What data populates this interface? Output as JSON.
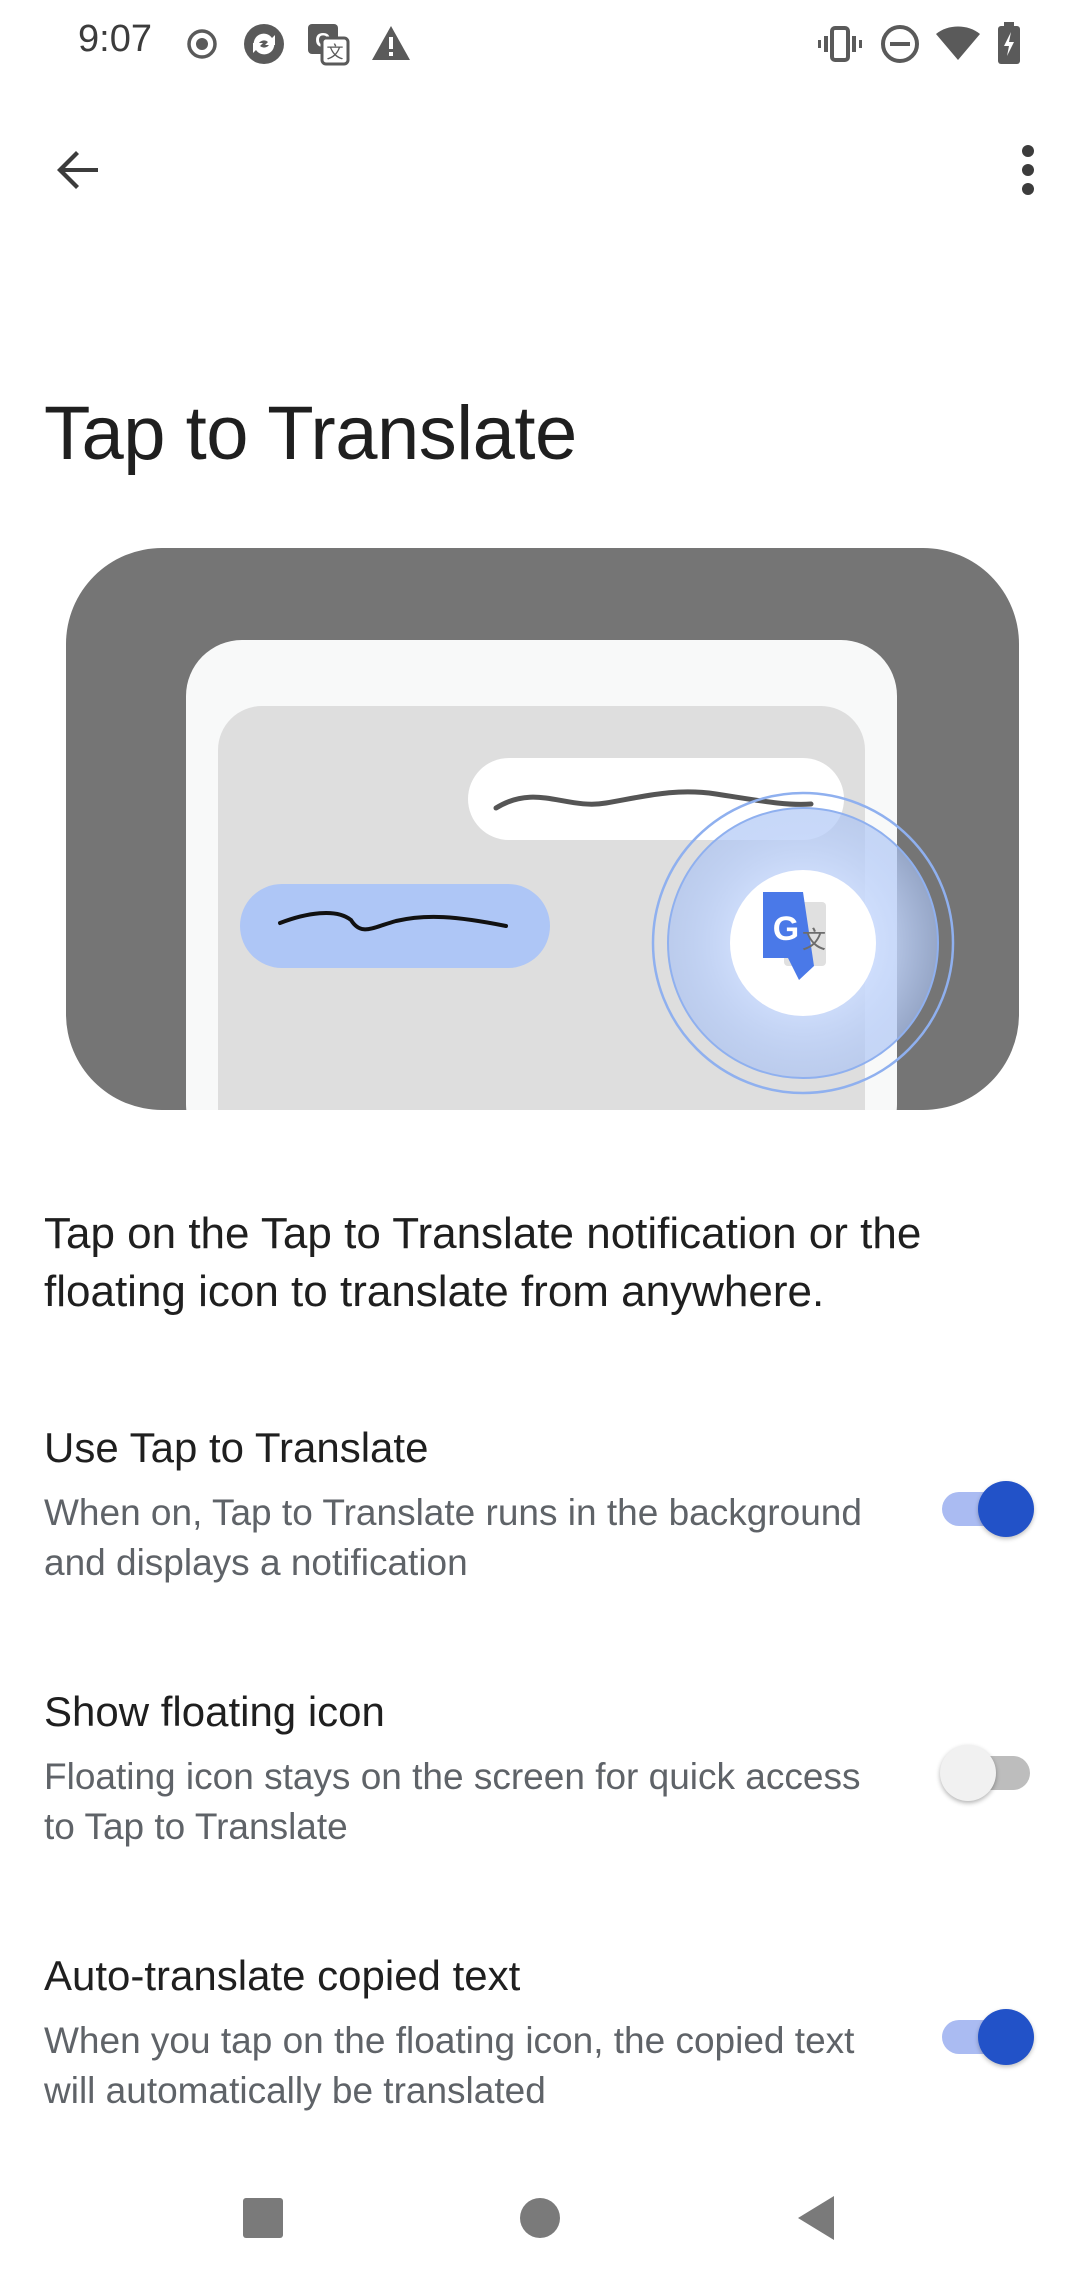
{
  "status_bar": {
    "time": "9:07",
    "left_icons": [
      "record-icon",
      "sync-icon",
      "translate-notification-icon",
      "warning-icon"
    ],
    "right_icons": [
      "vibrate-icon",
      "do-not-disturb-icon",
      "wifi-icon",
      "battery-charging-icon"
    ]
  },
  "app_bar": {
    "back_icon": "arrow-back-icon",
    "menu_icon": "more-vert-icon"
  },
  "page": {
    "title": "Tap to Translate",
    "description": "Tap on the Tap to Translate notification or the floating icon to translate from anywhere."
  },
  "settings": [
    {
      "title": "Use Tap to Translate",
      "summary": "When on, Tap to Translate runs in the background and displays a notification",
      "enabled": true
    },
    {
      "title": "Show floating icon",
      "summary": "Floating icon stays on the screen for quick access to Tap to Translate",
      "enabled": false
    },
    {
      "title": "Auto-translate copied text",
      "summary": "When you tap on the floating icon, the copied text will automatically be translated",
      "enabled": true
    }
  ],
  "illustration": {
    "logo_letter": "G",
    "logo_glyph": "文"
  },
  "nav_bar": {
    "icons": [
      "recents-square-icon",
      "home-circle-icon",
      "back-triangle-icon"
    ]
  },
  "colors": {
    "accent": "#2252c8",
    "accent_track": "#aabbf2",
    "illustration_bg": "#757575",
    "bubble_blue": "#aec6f6"
  }
}
